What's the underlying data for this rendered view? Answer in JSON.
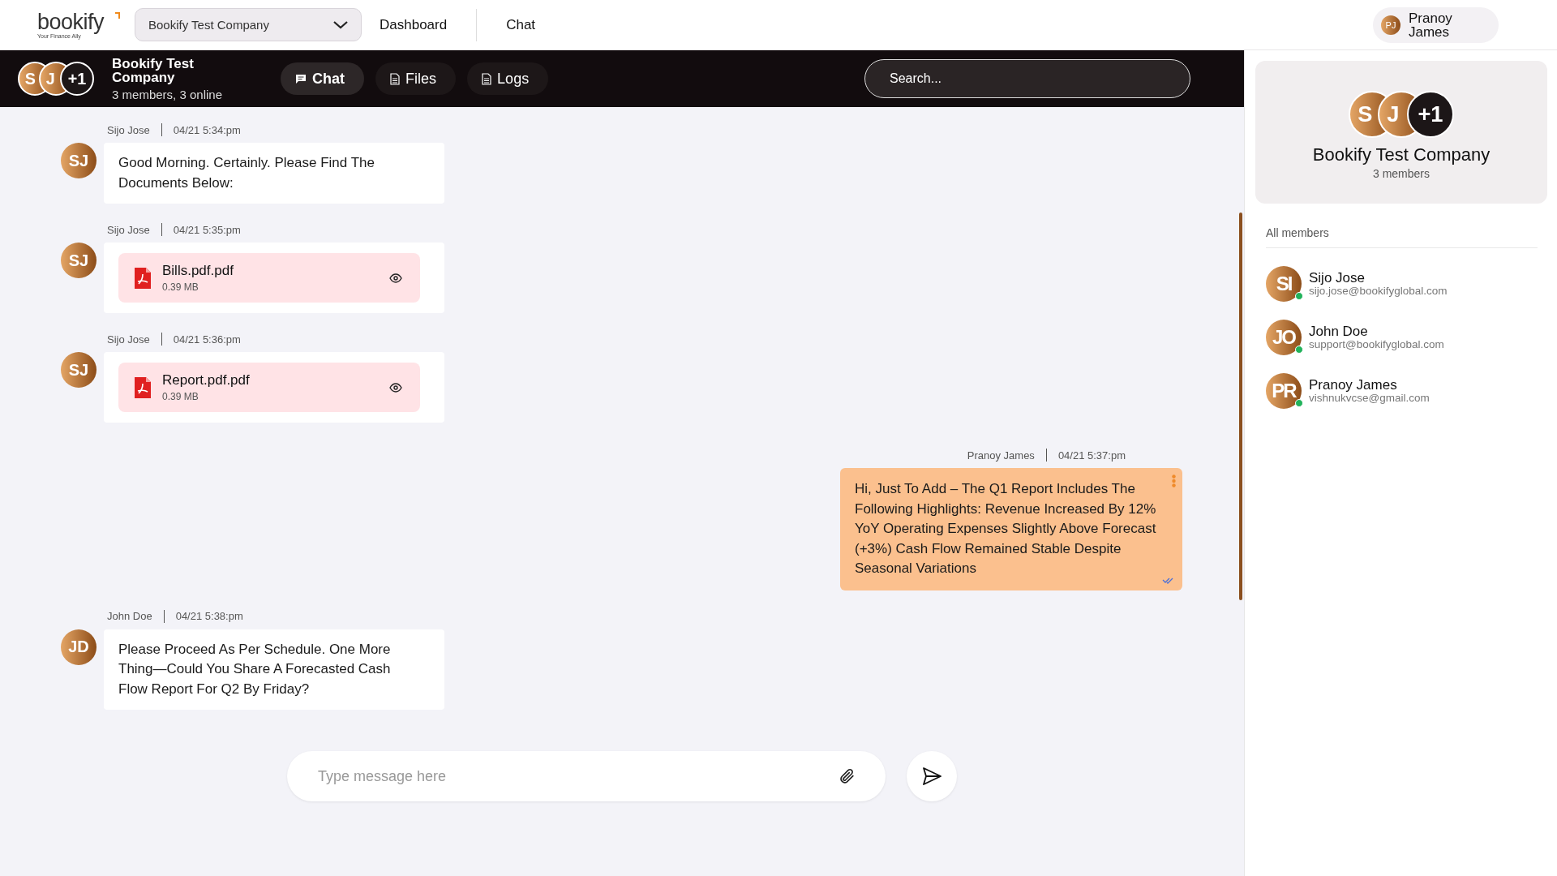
{
  "topbar": {
    "logo": "bookify",
    "tagline": "Your Finance Ally",
    "company_select": "Bookify Test Company",
    "nav": [
      {
        "label": "Dashboard"
      },
      {
        "label": "Chat"
      }
    ],
    "user": {
      "initials": "PJ",
      "name": "Pranoy James"
    }
  },
  "chat_header": {
    "avatars": [
      "S",
      "J",
      "+1"
    ],
    "title": "Bookify Test Company",
    "subtitle": "3 members, 3 online",
    "tabs": [
      {
        "label": "Chat",
        "selected": true,
        "kind": "chat"
      },
      {
        "label": "Files",
        "selected": false,
        "kind": "file"
      },
      {
        "label": "Logs",
        "selected": false,
        "kind": "file"
      }
    ],
    "search": {
      "placeholder": "Search..."
    }
  },
  "messages": [
    {
      "kind": "text",
      "outgoing": false,
      "sender": "Sijo Jose",
      "time": "04/21 5:34:pm",
      "avatar": "SJ",
      "text": "Good Morning. Certainly. Please Find The Documents Below:"
    },
    {
      "kind": "file",
      "outgoing": false,
      "sender": "Sijo Jose",
      "time": "04/21 5:35:pm",
      "avatar": "SJ",
      "file_name": "Bills.pdf.pdf",
      "file_size": "0.39 MB"
    },
    {
      "kind": "file",
      "outgoing": false,
      "sender": "Sijo Jose",
      "time": "04/21 5:36:pm",
      "avatar": "SJ",
      "file_name": "Report.pdf.pdf",
      "file_size": "0.39 MB"
    },
    {
      "kind": "text",
      "outgoing": true,
      "sender": "Pranoy James",
      "time": "04/21 5:37:pm",
      "text": "Hi, Just To Add – The Q1 Report Includes The Following Highlights: Revenue Increased By 12% YoY Operating Expenses Slightly Above Forecast (+3%) Cash Flow Remained Stable Despite Seasonal Variations"
    },
    {
      "kind": "text",
      "outgoing": false,
      "sender": "John Doe",
      "time": "04/21 5:38:pm",
      "avatar": "JD",
      "text": "Please Proceed As Per Schedule. One More Thing—Could You Share A Forecasted Cash Flow Report For Q2 By Friday?"
    }
  ],
  "composer": {
    "placeholder": "Type message here"
  },
  "group_panel": {
    "avatars": [
      "S",
      "J",
      "+1"
    ],
    "title": "Bookify Test Company",
    "subtitle": "3 members",
    "section": "All members",
    "members": [
      {
        "initials": "SI",
        "name": "Sijo Jose",
        "email": "sijo.jose@bookifyglobal.com",
        "online": true
      },
      {
        "initials": "JO",
        "name": "John Doe",
        "email": "support@bookifyglobal.com",
        "online": true
      },
      {
        "initials": "PR",
        "name": "Pranoy James",
        "email": "vishnukvcse@gmail.com",
        "online": true
      }
    ]
  }
}
